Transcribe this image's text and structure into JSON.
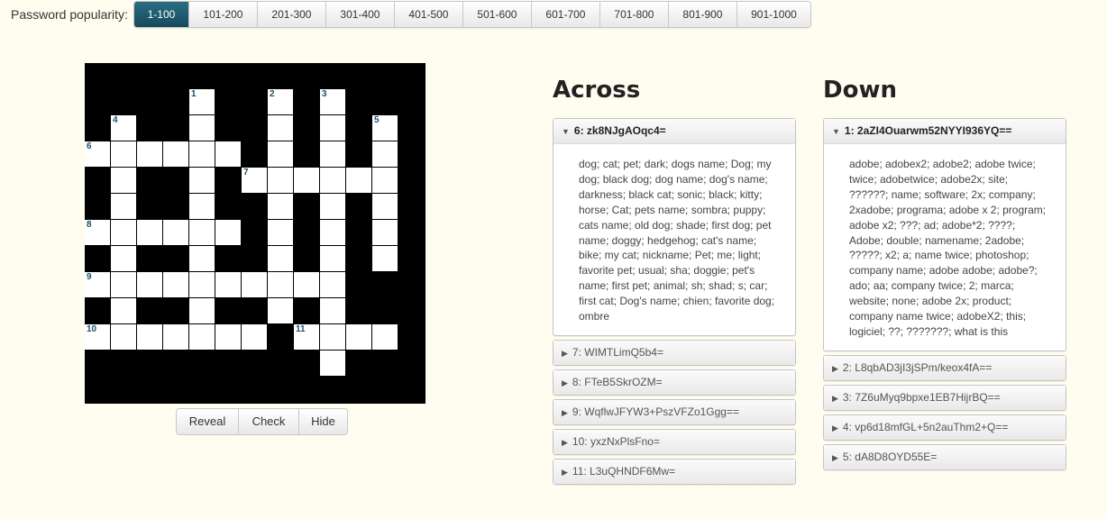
{
  "popularity": {
    "label": "Password popularity:",
    "ranges": [
      "1-100",
      "101-200",
      "201-300",
      "301-400",
      "401-500",
      "501-600",
      "601-700",
      "701-800",
      "801-900",
      "901-1000"
    ],
    "active": "1-100"
  },
  "grid_buttons": {
    "reveal": "Reveal",
    "check": "Check",
    "hide": "Hide"
  },
  "across": {
    "title": "Across",
    "clues": [
      {
        "head": "6: zk8NJgAOqc4=",
        "open": true,
        "text": "dog; cat; pet; dark; dogs name; Dog; my dog; black dog; dog name; dog's name; darkness; black cat; sonic; black; kitty; horse; Cat; pets name; sombra; puppy; cats name; old dog; shade; first dog; pet name; doggy; hedgehog; cat's name; bike; my cat; nickname; Pet; me; light; favorite pet; usual; sha; doggie; pet's name; first pet; animal; sh; shad; s; car; first cat; Dog's name; chien; favorite dog; ombre"
      },
      {
        "head": "7: WIMTLimQ5b4=",
        "open": false
      },
      {
        "head": "8: FTeB5SkrOZM=",
        "open": false
      },
      {
        "head": "9: WqflwJFYW3+PszVFZo1Ggg==",
        "open": false
      },
      {
        "head": "10: yxzNxPlsFno=",
        "open": false
      },
      {
        "head": "11: L3uQHNDF6Mw=",
        "open": false
      }
    ]
  },
  "down": {
    "title": "Down",
    "clues": [
      {
        "head": "1: 2aZI4Ouarwm52NYYI936YQ==",
        "open": true,
        "text": "adobe; adobex2; adobe2; adobe twice; twice; adobetwice; adobe2x; site; ??????; name; software; 2x; company; 2xadobe; programa; adobe x 2; program; adobe x2; ???; ad; adobe*2; ????; Adobe; double; namename; 2adobe; ?????; x2; a; name twice; photoshop; company name; adobe adobe; adobe?; ado; aa; company twice; 2; marca; website; none; adobe 2x; product; company name twice; adobeX2; this; logiciel; ??; ???????; what is this"
      },
      {
        "head": "2: L8qbAD3jI3jSPm/keox4fA==",
        "open": false
      },
      {
        "head": "3: 7Z6uMyq9bpxe1EB7HijrBQ==",
        "open": false
      },
      {
        "head": "4: vp6d18mfGL+5n2auThm2+Q==",
        "open": false
      },
      {
        "head": "5: dA8D8OYD55E=",
        "open": false
      }
    ]
  },
  "grid": {
    "numbers": {
      "1": "1",
      "2": "2",
      "3": "3",
      "4": "4",
      "5": "5",
      "6": "6",
      "7": "7",
      "8": "8",
      "9": "9",
      "10": "10",
      "11": "11"
    }
  }
}
